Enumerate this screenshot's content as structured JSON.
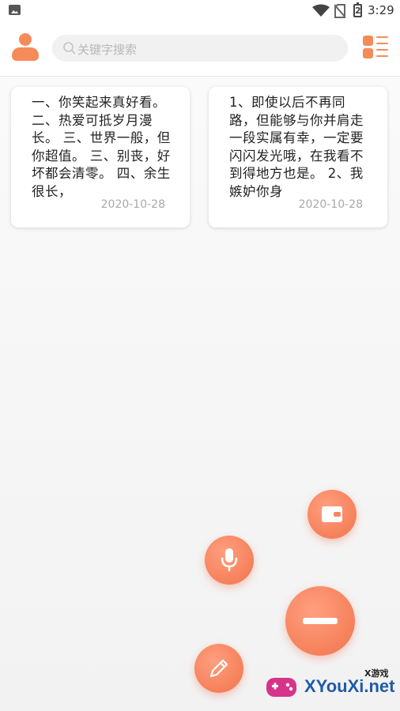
{
  "status_bar": {
    "time": "3:29",
    "battery_level": "2"
  },
  "header": {
    "search_placeholder": "关键字搜索"
  },
  "notes": [
    {
      "text": "一、你笑起来真好看。 二、热爱可抵岁月漫长。 三、世界一般，但你超值。 三、别丧，好坏都会清零。 四、余生很长，",
      "date": "2020-10-28"
    },
    {
      "text": "1、即使以后不再同路，但能够与你并肩走一段实属有幸，一定要闪闪发光哦，在我看不到得地方也是。 2、我嫉妒你身",
      "date": "2020-10-28"
    }
  ],
  "fab_menu": {
    "items": [
      "wallet-icon",
      "microphone-icon",
      "pencil-icon",
      "minus-icon"
    ],
    "accent": "#f7855f"
  },
  "watermark": {
    "brand": "XYouXi.net",
    "sub": "X游戏"
  }
}
